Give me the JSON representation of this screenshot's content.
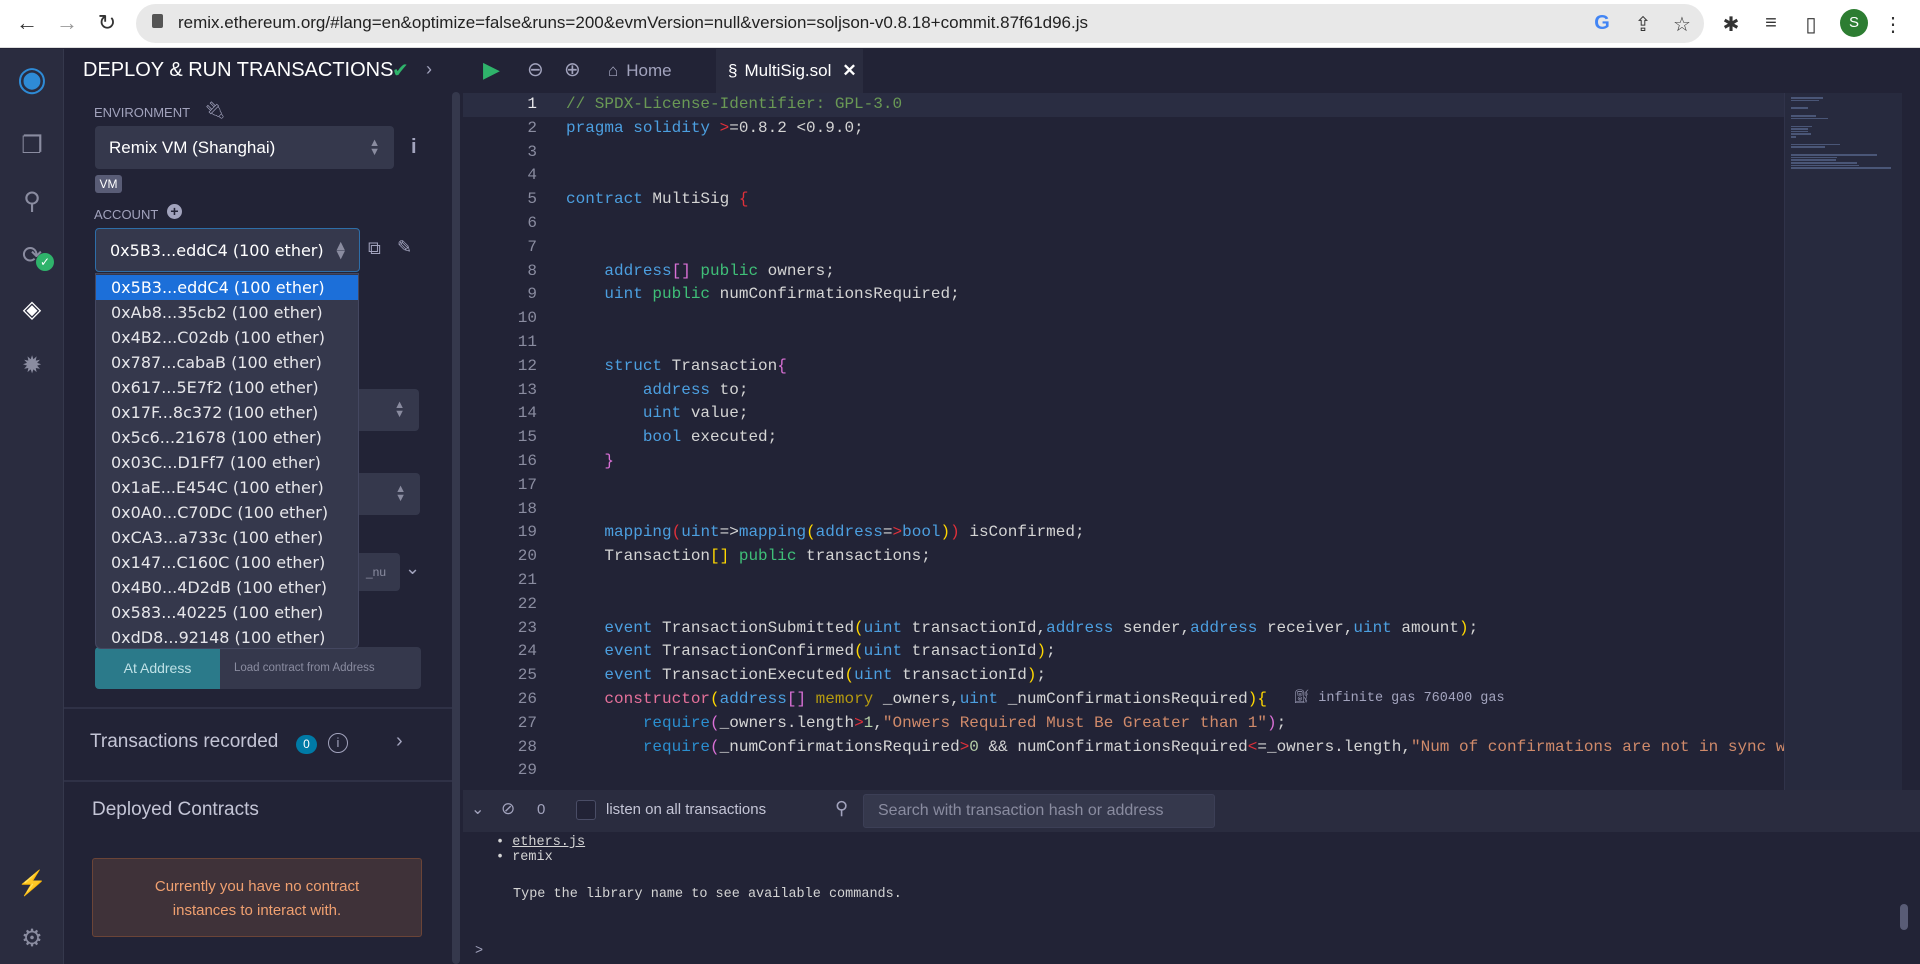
{
  "browser": {
    "url": "remix.ethereum.org/#lang=en&optimize=false&runs=200&evmVersion=null&version=soljson-v0.8.18+commit.87f61d96.js",
    "avatar_letter": "S"
  },
  "panel": {
    "title": "DEPLOY & RUN TRANSACTIONS",
    "environment_label": "ENVIRONMENT",
    "environment_value": "Remix VM (Shanghai)",
    "vm_badge": "VM",
    "account_label": "ACCOUNT",
    "account_value": "0x5B3...eddC4 (100 ether)",
    "accounts": [
      "0x5B3...eddC4 (100 ether)",
      "0xAb8...35cb2 (100 ether)",
      "0x4B2...C02db (100 ether)",
      "0x787...cabaB (100 ether)",
      "0x617...5E7f2 (100 ether)",
      "0x17F...8c372 (100 ether)",
      "0x5c6...21678 (100 ether)",
      "0x03C...D1Ff7 (100 ether)",
      "0x1aE...E454C (100 ether)",
      "0x0A0...C70DC (100 ether)",
      "0xCA3...a733c (100 ether)",
      "0x147...C160C (100 ether)",
      "0x4B0...4D2dB (100 ether)",
      "0x583...40225 (100 ether)",
      "0xdD8...92148 (100 ether)"
    ],
    "constructor_input_partial": "_nu",
    "at_address_label": "At Address",
    "load_address_placeholder": "Load contract from Address",
    "transactions_recorded_label": "Transactions recorded",
    "transactions_count": "0",
    "deployed_contracts_label": "Deployed Contracts",
    "no_contracts_message": "Currently you have no contract instances to interact with."
  },
  "tabs": {
    "home": "Home",
    "file": "MultiSig.sol"
  },
  "code": [
    [
      [
        "// SPDX-License-Identifier: GPL-3.0",
        "c"
      ]
    ],
    [
      [
        "pragma solidity ",
        "k"
      ],
      [
        ">",
        "r"
      ],
      [
        "=0.8.2 <0.9.0;",
        "t"
      ]
    ],
    [],
    [],
    [
      [
        "contract ",
        "k"
      ],
      [
        "MultiSig ",
        "t"
      ],
      [
        "{",
        "r"
      ]
    ],
    [],
    [],
    [
      [
        "    address",
        "k"
      ],
      [
        "[]",
        "b1"
      ],
      [
        " public",
        "p"
      ],
      [
        " owners;",
        "t"
      ]
    ],
    [
      [
        "    uint",
        "k"
      ],
      [
        " public",
        "p"
      ],
      [
        " numConfirmationsRequired;",
        "t"
      ]
    ],
    [],
    [],
    [
      [
        "    struct ",
        "k"
      ],
      [
        "Transaction",
        "t"
      ],
      [
        "{",
        "b1"
      ]
    ],
    [
      [
        "        address ",
        "k"
      ],
      [
        "to;",
        "t"
      ]
    ],
    [
      [
        "        uint ",
        "k"
      ],
      [
        "value;",
        "t"
      ]
    ],
    [
      [
        "        bool ",
        "k"
      ],
      [
        "executed;",
        "t"
      ]
    ],
    [
      [
        "    }",
        "b1"
      ]
    ],
    [],
    [],
    [
      [
        "    mapping",
        "k"
      ],
      [
        "(",
        "r"
      ],
      [
        "uint",
        "k"
      ],
      [
        "=>",
        "t"
      ],
      [
        "mapping",
        "k"
      ],
      [
        "(",
        "b2"
      ],
      [
        "address",
        "k"
      ],
      [
        "=",
        "t"
      ],
      [
        ">",
        "r"
      ],
      [
        "bool",
        "k"
      ],
      [
        ")",
        "b2"
      ],
      [
        ")",
        "r"
      ],
      [
        " isConfirmed;",
        "t"
      ]
    ],
    [
      [
        "    Transaction",
        "t"
      ],
      [
        "[]",
        "b2"
      ],
      [
        " public",
        "p"
      ],
      [
        " transactions;",
        "t"
      ]
    ],
    [],
    [],
    [
      [
        "    event ",
        "k"
      ],
      [
        "TransactionSubmitted",
        "t"
      ],
      [
        "(",
        "b2"
      ],
      [
        "uint ",
        "k"
      ],
      [
        "transactionId,",
        "t"
      ],
      [
        "address ",
        "k"
      ],
      [
        "sender,",
        "t"
      ],
      [
        "address ",
        "k"
      ],
      [
        "receiver,",
        "t"
      ],
      [
        "uint ",
        "k"
      ],
      [
        "amount",
        "t"
      ],
      [
        ")",
        "b2"
      ],
      [
        ";",
        "t"
      ]
    ],
    [
      [
        "    event ",
        "k"
      ],
      [
        "TransactionConfirmed",
        "t"
      ],
      [
        "(",
        "b2"
      ],
      [
        "uint ",
        "k"
      ],
      [
        "transactionId",
        "t"
      ],
      [
        ")",
        "b2"
      ],
      [
        ";",
        "t"
      ]
    ],
    [
      [
        "    event ",
        "k"
      ],
      [
        "TransactionExecuted",
        "t"
      ],
      [
        "(",
        "b2"
      ],
      [
        "uint ",
        "k"
      ],
      [
        "transactionId",
        "t"
      ],
      [
        ")",
        "b2"
      ],
      [
        ";",
        "t"
      ]
    ],
    [
      [
        "    constructor",
        "f"
      ],
      [
        "(",
        "b2"
      ],
      [
        "address",
        "k"
      ],
      [
        "[]",
        "b1"
      ],
      [
        " memory",
        "m"
      ],
      [
        " _owners,",
        "t"
      ],
      [
        "uint ",
        "k"
      ],
      [
        "_numConfirmationsRequired",
        "t"
      ],
      [
        ")",
        "b2"
      ],
      [
        "{",
        "b2"
      ]
    ],
    [
      [
        "        require",
        "q"
      ],
      [
        "(",
        "b1"
      ],
      [
        "_owners.length",
        "t"
      ],
      [
        ">",
        "r"
      ],
      [
        "1",
        "n"
      ],
      [
        ",",
        "t"
      ],
      [
        "\"Onwers Required Must Be Greater than 1\"",
        "s"
      ],
      [
        ")",
        "b1"
      ],
      [
        ";",
        "t"
      ]
    ],
    [
      [
        "        require",
        "q"
      ],
      [
        "(",
        "b1"
      ],
      [
        "_numConfirmationsRequired",
        "t"
      ],
      [
        ">",
        "r"
      ],
      [
        "0",
        "n"
      ],
      [
        " && numConfirmationsRequired",
        "t"
      ],
      [
        "<",
        "r"
      ],
      [
        "=_owners.length,",
        "t"
      ],
      [
        "\"Num of confirmations are not in sync w",
        "s"
      ]
    ],
    []
  ],
  "gas_estimate": "infinite gas 760400 gas",
  "terminal": {
    "pending_count": "0",
    "listen_label": "listen on all transactions",
    "search_placeholder": "Search with transaction hash or address",
    "libs": [
      "ethers.js",
      "remix"
    ],
    "hint": "Type the library name to see available commands.",
    "prompt": ">"
  },
  "colors": {
    "accent": "#1c6fd9",
    "badge": "#007aa6",
    "at_address": "#2b7a8a",
    "alert_bg": "#3f3239",
    "alert_text": "#f0a070"
  }
}
